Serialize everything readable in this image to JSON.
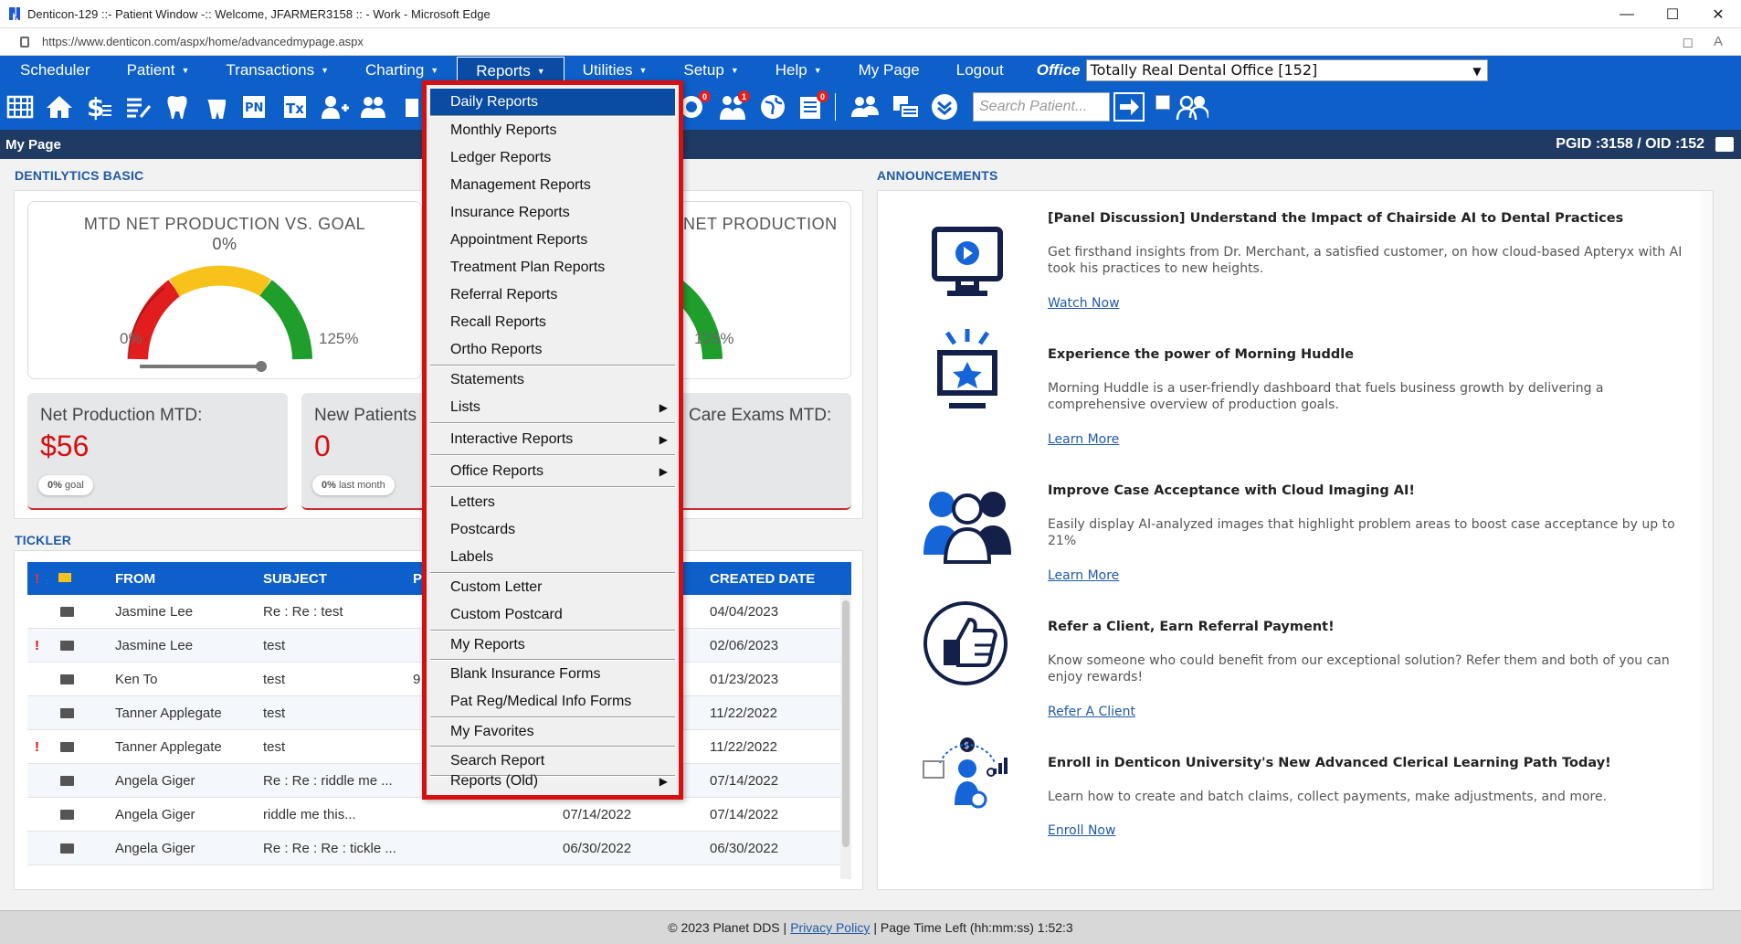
{
  "browser": {
    "title": "Denticon-129 ::- Patient Window -:: Welcome, JFARMER3158 :: - Work - Microsoft Edge",
    "url": "https://www.denticon.com/aspx/home/advancedmypage.aspx"
  },
  "menubar": {
    "items": [
      "Scheduler",
      "Patient",
      "Transactions",
      "Charting",
      "Reports",
      "Utilities",
      "Setup",
      "Help",
      "My Page",
      "Logout"
    ],
    "office_label": "Office",
    "office_value": "Totally Real Dental Office [152]"
  },
  "toolbar": {
    "search_placeholder": "Search Patient...",
    "badges": [
      "0",
      "1",
      "0"
    ]
  },
  "pagebar": {
    "title": "My Page",
    "ids": "PGID :3158  /  OID :152"
  },
  "dentilytics": {
    "title": "DENTILYTICS BASIC",
    "gauge1_title": "MTD NET PRODUCTION VS. GOAL",
    "gauge1_value": "0%",
    "gauge2_title": "NET PRODUCTION",
    "gauge_min": "0%",
    "gauge_max": "125%",
    "metric1_label": "Net Production MTD:",
    "metric1_value": "$56",
    "metric1_pill_value": "0%",
    "metric1_pill_label": "goal",
    "metric2_label": "New Patients",
    "metric2_value": "0",
    "metric2_pill_value": "0%",
    "metric2_pill_label": "last month",
    "metric3_label": "Care Exams MTD:"
  },
  "tickler": {
    "title": "TICKLER",
    "headers": {
      "from": "FROM",
      "subject": "SUBJECT",
      "p": "P",
      "created": "CREATED DATE"
    },
    "rows": [
      {
        "flag": "",
        "from": "Jasmine Lee",
        "subject": "Re : Re : test",
        "col4": "",
        "created": "04/04/2023"
      },
      {
        "flag": "!",
        "from": "Jasmine Lee",
        "subject": "test",
        "col4": "",
        "created": "02/06/2023"
      },
      {
        "flag": "",
        "from": "Ken To",
        "subject": "test",
        "col4": "9",
        "created": "01/23/2023"
      },
      {
        "flag": "",
        "from": "Tanner Applegate",
        "subject": "test",
        "col4": "",
        "created": "11/22/2022"
      },
      {
        "flag": "!",
        "from": "Tanner Applegate",
        "subject": "test",
        "col4": "",
        "created": "11/22/2022"
      },
      {
        "flag": "",
        "from": "Angela Giger",
        "subject": "Re : Re : riddle me ...",
        "col4": "",
        "created": "07/14/2022"
      },
      {
        "flag": "",
        "from": "Angela Giger",
        "subject": "riddle me this...",
        "col4": "07/14/2022",
        "created": "07/14/2022"
      },
      {
        "flag": "",
        "from": "Angela Giger",
        "subject": "Re : Re : Re : tickle ...",
        "col4": "06/30/2022",
        "created": "06/30/2022"
      }
    ]
  },
  "announcements": {
    "title": "ANNOUNCEMENTS",
    "items": [
      {
        "title": "[Panel Discussion] Understand the Impact of Chairside AI to Dental Practices",
        "body": "Get firsthand insights from Dr. Merchant, a satisfied customer, on how cloud-based Apteryx with AI took his practices to new heights.",
        "link": "Watch Now"
      },
      {
        "title": "Experience the power of Morning Huddle",
        "body": "Morning Huddle is a user-friendly dashboard that fuels business growth by delivering a comprehensive overview of production goals.",
        "link": "Learn More"
      },
      {
        "title": "Improve Case Acceptance with Cloud Imaging AI!",
        "body": "Easily display AI-analyzed images that highlight problem areas to boost case acceptance by up to 21%",
        "link": "Learn More"
      },
      {
        "title": "Refer a Client, Earn Referral Payment!",
        "body": "Know someone who could benefit from our exceptional solution? Refer them and both of you can enjoy rewards!",
        "link": "Refer A Client"
      },
      {
        "title": "Enroll in Denticon University's New Advanced Clerical Learning Path Today!",
        "body": "Learn how to create and batch claims, collect payments, make adjustments, and more.",
        "link": "Enroll Now"
      }
    ]
  },
  "reports_menu": {
    "items": [
      "Daily Reports",
      "Monthly Reports",
      "Ledger Reports",
      "Management Reports",
      "Insurance Reports",
      "Appointment Reports",
      "Treatment Plan Reports",
      "Referral Reports",
      "Recall Reports",
      "Ortho Reports",
      "Statements",
      "Lists",
      "Interactive Reports",
      "Office Reports",
      "Letters",
      "Postcards",
      "Labels",
      "Custom Letter",
      "Custom Postcard",
      "My Reports",
      "Blank Insurance Forms",
      "Pat Reg/Medical Info Forms",
      "My Favorites",
      "Search Report",
      "Reports (Old)"
    ]
  },
  "footer": {
    "copyright": "© 2023 Planet DDS |",
    "privacy": "Privacy Policy",
    "time_left": "| Page Time Left (hh:mm:ss) 1:52:3"
  }
}
